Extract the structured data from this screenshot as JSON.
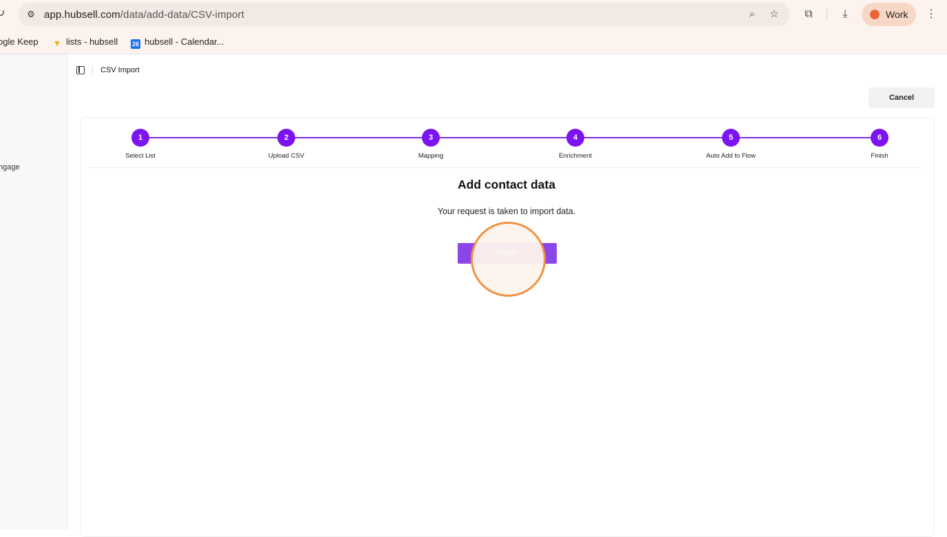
{
  "browser": {
    "url_host": "app.hubsell.com",
    "url_path": "/data/add-data/CSV-import",
    "profile_label": "Work",
    "bookmarks": [
      {
        "label": "ogle Keep"
      },
      {
        "label": "lists - hubsell"
      },
      {
        "label": "hubsell - Calendar..."
      }
    ],
    "calendar_badge": "26"
  },
  "sidebar": {
    "visible_item": "ngage"
  },
  "topbar": {
    "breadcrumb": "CSV Import",
    "cancel_label": "Cancel"
  },
  "steps": [
    {
      "number": "1",
      "label": "Select List"
    },
    {
      "number": "2",
      "label": "Upload CSV"
    },
    {
      "number": "3",
      "label": "Mapping"
    },
    {
      "number": "4",
      "label": "Enrichment"
    },
    {
      "number": "5",
      "label": "Auto Add to Flow"
    },
    {
      "number": "6",
      "label": "Finish"
    }
  ],
  "main": {
    "heading": "Add contact data",
    "message": "Your request is taken to import data.",
    "finish_label": "Finish"
  },
  "colors": {
    "accent": "#7b14f0",
    "button": "#8b45e8",
    "highlight_ring": "#f09040"
  }
}
